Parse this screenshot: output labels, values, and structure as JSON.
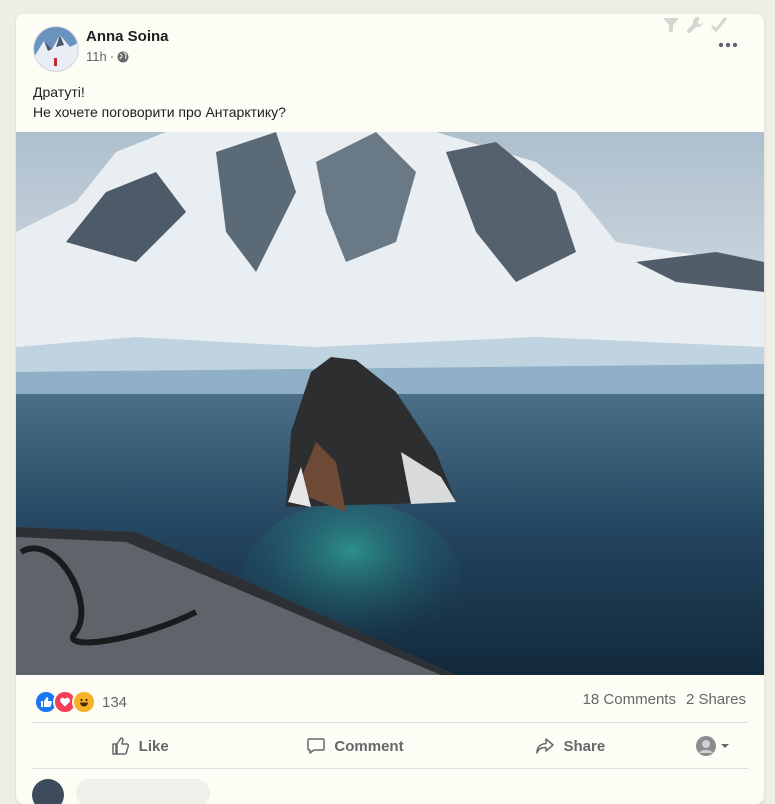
{
  "post": {
    "author": "Anna Soina",
    "time": "11h",
    "privacy_icon": "globe-icon",
    "text_lines": [
      "Дратуті!",
      "Не хочете поговорити про Антарктику?"
    ]
  },
  "reactions": {
    "icons": [
      "like-reaction-icon",
      "love-reaction-icon",
      "haha-reaction-icon"
    ],
    "count": "134"
  },
  "stats": {
    "comments": "18 Comments",
    "shares": "2 Shares"
  },
  "actions": {
    "like": "Like",
    "comment": "Comment",
    "share": "Share"
  },
  "colors": {
    "like_blue": "#1877f2",
    "love_red": "#f33e58",
    "haha_yellow": "#f7b125",
    "background": "#efeee6",
    "card": "#fdfcf5"
  }
}
